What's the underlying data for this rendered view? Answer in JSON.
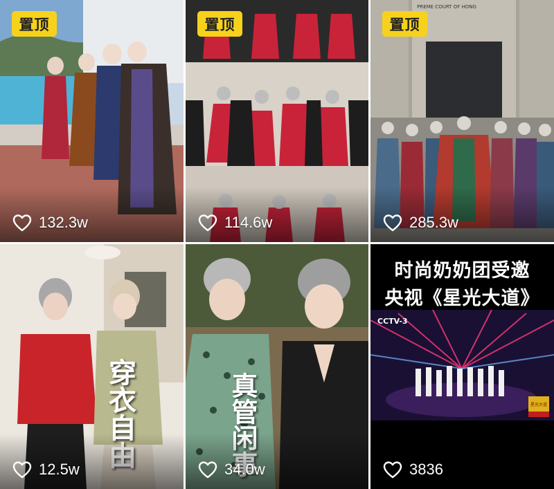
{
  "feed": {
    "pinned_label": "置顶",
    "videos": [
      {
        "likes": "132.3w",
        "pinned": true
      },
      {
        "likes": "114.6w",
        "pinned": true
      },
      {
        "likes": "285.3w",
        "pinned": true,
        "building_sign": "PREME COURT OF HONG"
      },
      {
        "likes": "12.5w",
        "overlay_text": "穿衣自由"
      },
      {
        "likes": "34.0w",
        "overlay_text": "真管闲事"
      },
      {
        "likes": "3836",
        "headline_line1": "时尚奶奶团受邀",
        "headline_line2": "央视《星光大道》",
        "logo": "CCTV-3",
        "badge": "星光大道"
      }
    ]
  },
  "colors": {
    "pin_bg": "#f7d21c",
    "pin_text": "#222222",
    "likes_text": "#ffffff"
  },
  "icons": {
    "like": "heart-outline-icon"
  }
}
